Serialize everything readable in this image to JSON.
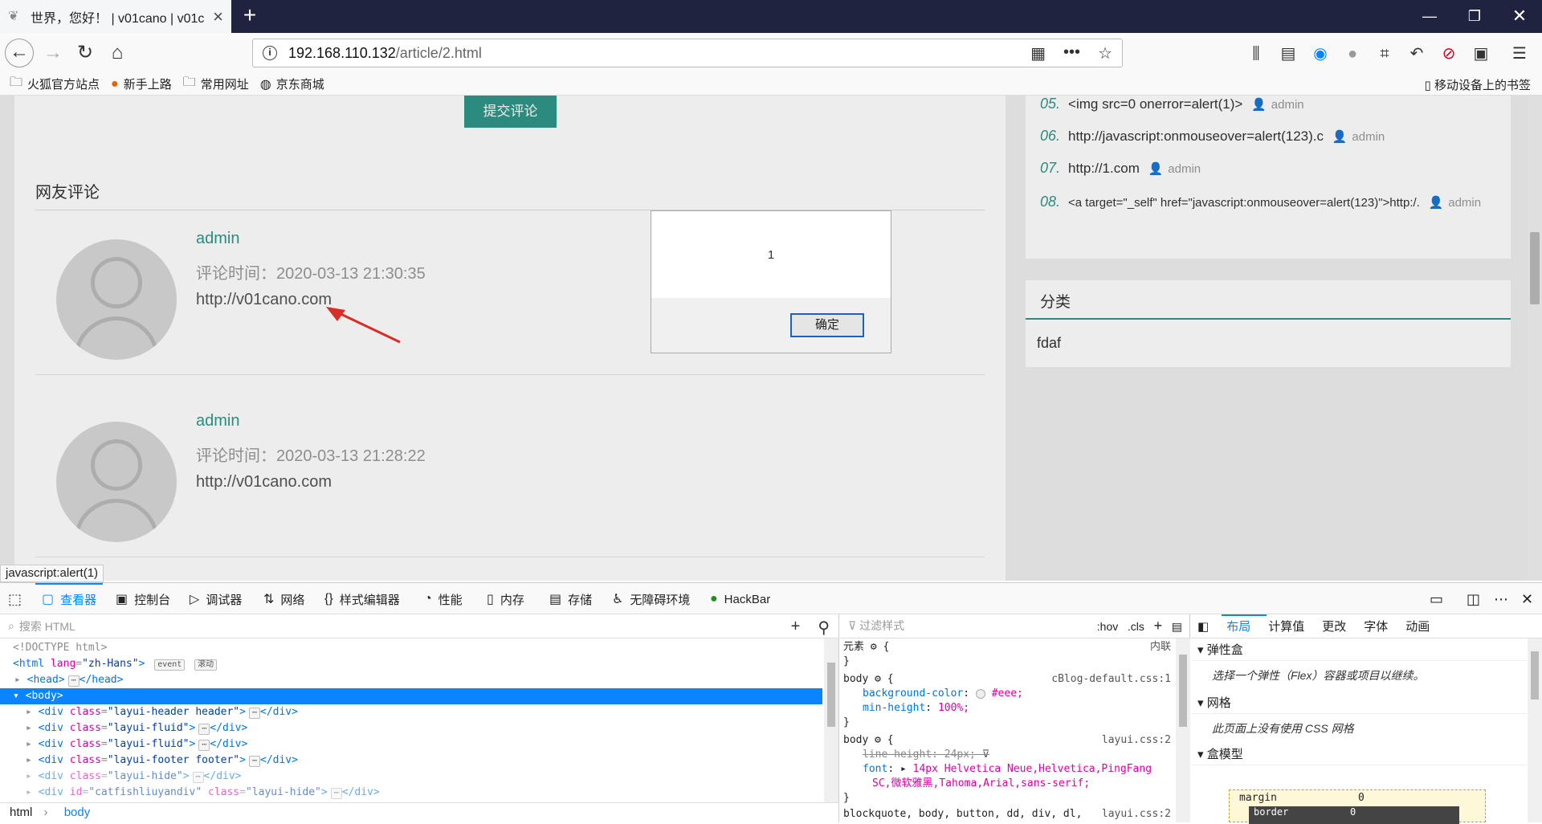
{
  "browser": {
    "tab_title": "世界，您好！ | v01cano | v01c",
    "url_host": "192.168.110.132",
    "url_path": "/article/2.html",
    "bookmarks": [
      {
        "label": "火狐官方站点",
        "icon": "folder-icon"
      },
      {
        "label": "新手上路",
        "icon": "firefox-icon"
      },
      {
        "label": "常用网址",
        "icon": "folder-icon"
      },
      {
        "label": "京东商城",
        "icon": "globe-icon"
      }
    ],
    "mobile_bookmarks": "移动设备上的书签",
    "status_link": "javascript:alert(1)"
  },
  "page": {
    "submit_label": "提交评论",
    "comments_heading": "网友评论",
    "comments": [
      {
        "author": "admin",
        "time": "评论时间：2020-03-13 21:30:35",
        "url": "http://v01cano.com"
      },
      {
        "author": "admin",
        "time": "评论时间：2020-03-13 21:28:22",
        "url": "http://v01cano.com"
      }
    ],
    "recent": [
      {
        "num": "05.",
        "text": "<img src=0 onerror=alert(1)>",
        "author": "admin"
      },
      {
        "num": "06.",
        "text": "http://javascript:onmouseover=alert(123).c",
        "author": "admin"
      },
      {
        "num": "07.",
        "text": "http://1.com",
        "author": "admin"
      },
      {
        "num": "08.",
        "text": "<a target=\"_self\" href=\"javascript:onmouseover=alert(123)\">http:/.",
        "author": "admin"
      }
    ],
    "category_heading": "分类",
    "category_item": "fdaf"
  },
  "dialog": {
    "message": "1",
    "ok_label": "确定"
  },
  "devtools": {
    "tabs": [
      {
        "label": "查看器",
        "icon": "inspector-icon"
      },
      {
        "label": "控制台",
        "icon": "console-icon"
      },
      {
        "label": "调试器",
        "icon": "debugger-icon"
      },
      {
        "label": "网络",
        "icon": "network-icon"
      },
      {
        "label": "样式编辑器",
        "icon": "style-editor-icon"
      },
      {
        "label": "性能",
        "icon": "performance-icon"
      },
      {
        "label": "内存",
        "icon": "memory-icon"
      },
      {
        "label": "存储",
        "icon": "storage-icon"
      },
      {
        "label": "无障碍环境",
        "icon": "accessibility-icon"
      },
      {
        "label": "HackBar",
        "icon": "hackbar-icon"
      }
    ],
    "html_search_placeholder": "搜索 HTML",
    "tree": {
      "doctype": "<!DOCTYPE html>",
      "html_tag": "<html",
      "html_attr": "lang",
      "html_val": "\"zh-Hans\"",
      "html_end": ">",
      "badge_event": "event",
      "badge_scroll": "滚动",
      "head": "<head>",
      "head_close": "</head>",
      "body": "<body>",
      "divs": [
        {
          "attr": "class",
          "val": "\"layui-header header\""
        },
        {
          "attr": "class",
          "val": "\"layui-fluid\""
        },
        {
          "attr": "class",
          "val": "\"layui-fluid\""
        },
        {
          "attr": "class",
          "val": "\"layui-footer footer\""
        },
        {
          "attr": "class",
          "val": "\"layui-hide\""
        },
        {
          "attr": "id",
          "val": "\"catfishliuyandiv\"",
          "attr2": "class",
          "val2": "\"layui-hide\""
        }
      ],
      "div_open": "<div",
      "div_close": "</div>",
      "ellipsis": "⋯"
    },
    "breadcrumbs": [
      "html",
      "body"
    ],
    "rules": {
      "filter_placeholder": "过滤样式",
      "hov": ":hov",
      "cls": ".cls",
      "element_label": "元素",
      "inline_label": "内联",
      "r1_selector": "body",
      "r1_source": "cBlog-default.css:1",
      "r1_p1": "background-color",
      "r1_v1": "#eee;",
      "r1_p2": "min-height",
      "r1_v2": "100%;",
      "r2_selector": "body",
      "r2_source": "layui.css:2",
      "r2_p1": "line-height",
      "r2_v1": "24px;",
      "r2_p2": "font",
      "r2_v2": "14px Helvetica Neue,Helvetica,PingFang",
      "r2_v2b": "SC,微软雅黑,Tahoma,Arial,sans-serif;",
      "r3_selector": "blockquote, body, button, dd, div, dl,",
      "r3_source": "layui.css:2"
    },
    "layout_tabs": [
      "布局",
      "计算值",
      "更改",
      "字体",
      "动画"
    ],
    "sections": {
      "flex_head": "弹性盒",
      "flex_body": "选择一个弹性（Flex）容器或项目以继续。",
      "grid_head": "网格",
      "grid_body": "此页面上没有使用 CSS 网格",
      "box_head": "盒模型",
      "margin_label": "margin",
      "margin_val": "0",
      "border_label": "border",
      "border_val": "0"
    }
  }
}
